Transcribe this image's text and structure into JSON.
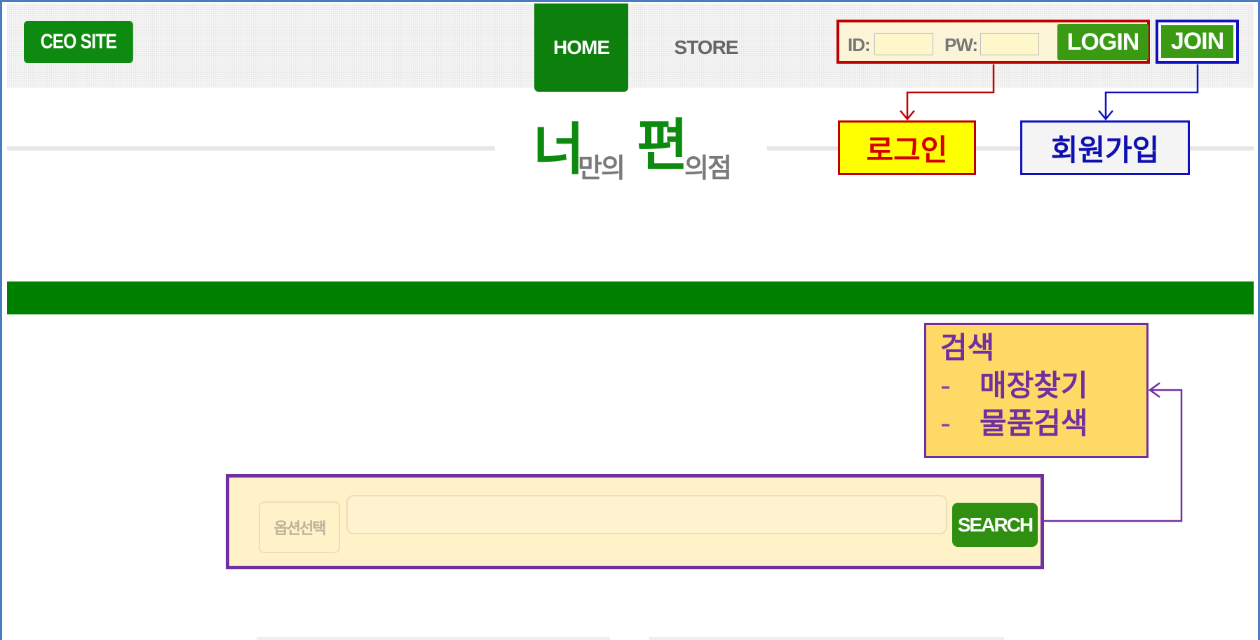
{
  "header": {
    "ceo_site_label": "CEO SITE",
    "nav": {
      "home_label": "HOME",
      "store_label": "STORE"
    },
    "login": {
      "id_label": "ID:",
      "id_value": "",
      "pw_label": "PW:",
      "pw_value": "",
      "login_label": "LOGIN"
    },
    "join_label": "JOIN"
  },
  "logo": {
    "char1": "너",
    "text1": "만의",
    "char2": "편",
    "text2": "의점"
  },
  "annotations": {
    "login_callout": "로그인",
    "join_callout": "회원가입",
    "search_callout": {
      "title": "검색",
      "dash": "-",
      "items": [
        "매장찾기",
        "물품검색"
      ]
    }
  },
  "search": {
    "option_label": "옵션선택",
    "input_value": "",
    "button_label": "SEARCH"
  },
  "colors": {
    "primary_green": "#008000",
    "login_outline": "#c00000",
    "join_outline": "#1010c0",
    "search_outline": "#7030a0",
    "login_callout_bg": "#ffff00",
    "search_callout_bg": "#ffd966"
  }
}
